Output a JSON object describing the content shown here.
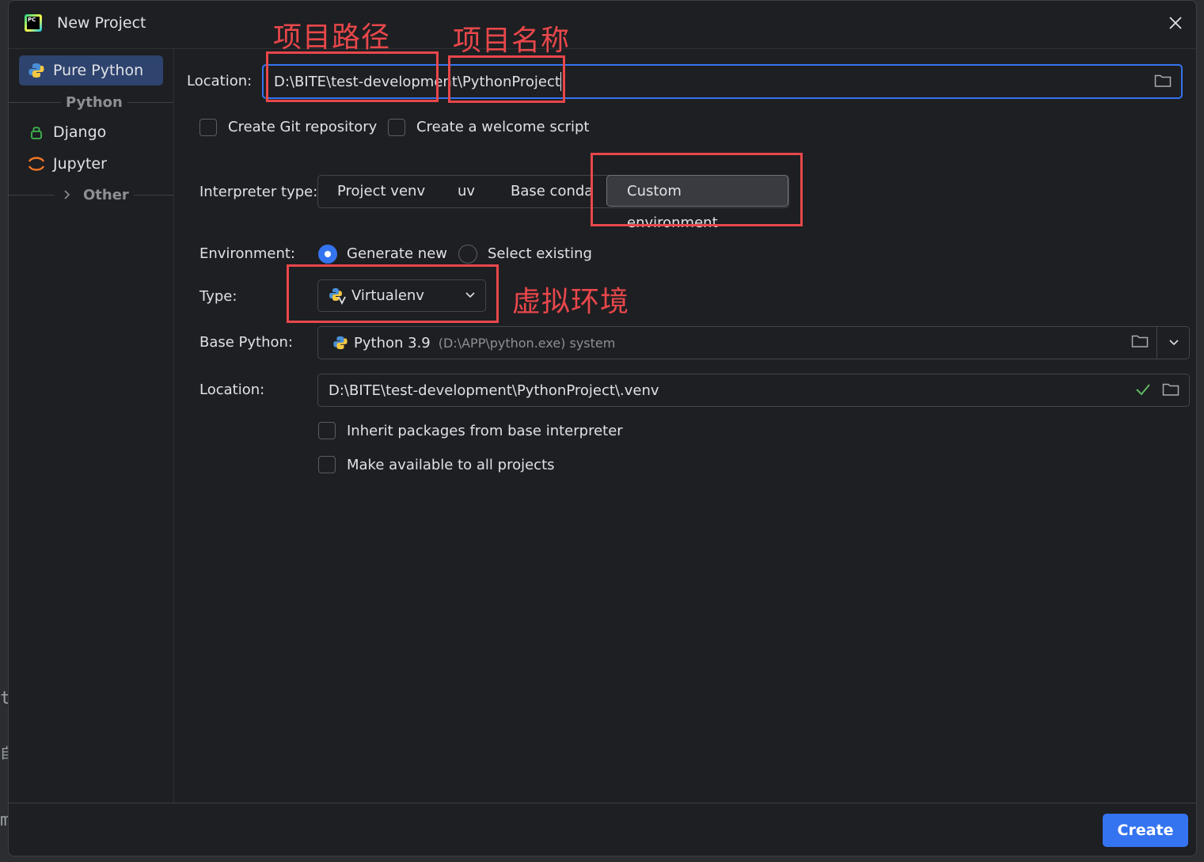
{
  "window": {
    "title": "New Project"
  },
  "background": {
    "glyph_1": "t",
    "glyph_2": "自",
    "glyph_3": "m"
  },
  "sidebar": {
    "items": [
      {
        "label": "Pure Python",
        "icon": "python-icon",
        "selected": true
      },
      {
        "label": "Django",
        "icon": "django-icon"
      },
      {
        "label": "Jupyter",
        "icon": "jupyter-icon"
      }
    ],
    "sections": {
      "python": "Python",
      "other": "Other"
    }
  },
  "project": {
    "location_label": "Location:",
    "location_path": "D:\\BITE\\test-development\\",
    "location_name": "PythonProject",
    "create_git_label": "Create Git repository",
    "welcome_script_label": "Create a welcome script"
  },
  "interpreter": {
    "label": "Interpreter type:",
    "options": [
      "Project venv",
      "uv",
      "Base conda",
      "Custom environment"
    ],
    "selected": "Custom environment"
  },
  "environment": {
    "label": "Environment:",
    "generate_new": "Generate new",
    "select_existing": "Select existing",
    "selected": "Generate new"
  },
  "type": {
    "label": "Type:",
    "value": "Virtualenv"
  },
  "base_python": {
    "label": "Base Python:",
    "version": "Python 3.9",
    "detail": "(D:\\APP\\python.exe) system"
  },
  "venv_location": {
    "label": "Location:",
    "value": "D:\\BITE\\test-development\\PythonProject\\.venv"
  },
  "options": {
    "inherit_packages": "Inherit packages from base interpreter",
    "make_available": "Make available to all projects"
  },
  "annotations": {
    "project_path": "项目路径",
    "project_name": "项目名称",
    "virtual_env": "虚拟环境",
    "color": "#e8474b"
  },
  "footer": {
    "create_label": "Create"
  },
  "colors": {
    "accent": "#3574f0",
    "selected_bg": "#2e436e",
    "valid_check": "#5fb865"
  }
}
